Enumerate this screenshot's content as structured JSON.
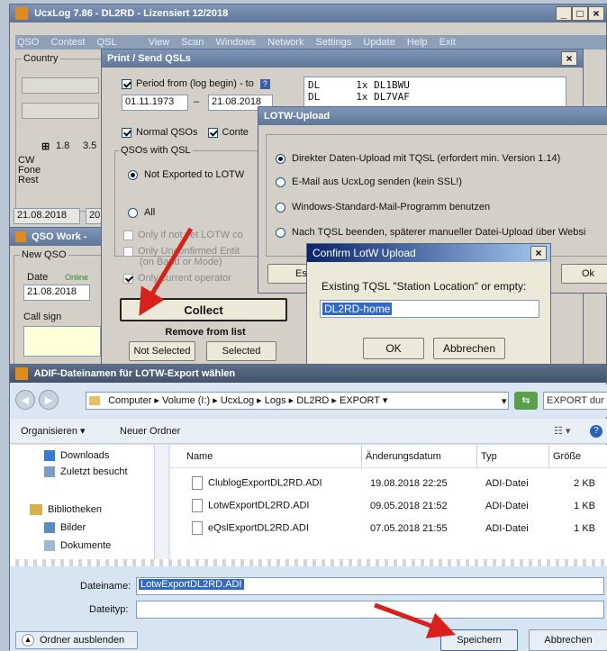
{
  "main_window": {
    "title": "UcxLog 7.86 - DL2RD - Lizensiert 12/2018",
    "menu": [
      "QSO",
      "Contest",
      "QSL",
      "View",
      "Scan",
      "Windows",
      "Network",
      "Settings",
      "Update",
      "Help",
      "Exit"
    ],
    "country_label": "Country",
    "stats_col1": "1.8",
    "stats_col2": "3.5",
    "row_labels": [
      "CW",
      "Fone",
      "Rest"
    ],
    "date_value": "21.08.2018",
    "date_partial": "20"
  },
  "qso_work": {
    "title": "QSO Work -",
    "new_qso": "New QSO",
    "date_label": "Date",
    "online_label": "Online",
    "date_value": "21.08.2018",
    "callsign_label": "Call sign"
  },
  "print_send": {
    "title": "Print / Send QSLs",
    "period_label": "Period from (log begin) - to",
    "date_from": "01.11.1973",
    "date_to": "21.08.2018",
    "normal_qsos": "Normal QSOs",
    "conte_partial": "Conte",
    "qsos_with_qsl": "QSOs with QSL",
    "not_exported": "Not Exported to LOTW",
    "all": "All",
    "only_not_yet": "Only if not yet LOTW co",
    "only_unconfirmed": "Only Unconfirmed Entit",
    "on_band_mode": "(on Band or Mode)",
    "only_current": "Only current operator",
    "collect": "Collect",
    "remove_from_list": "Remove from list",
    "not_selected": "Not Selected",
    "selected": "Selected",
    "list_rows": [
      {
        "a": "DL",
        "b": "1x DL1BWU"
      },
      {
        "a": "DL",
        "b": "1x DL7VAF"
      }
    ]
  },
  "lotw_upload": {
    "title": "LOTW-Upload",
    "opt1": "Direkter Daten-Upload mit TQSL (erfordert min. Version 1.14)",
    "opt2": "E-Mail aus UcxLog senden (kein SSL!)",
    "opt3": "Windows-Standard-Mail-Programm benutzen",
    "opt4": "Nach TQSL beenden, späterer manueller Datei-Upload über Websi",
    "es_partial": "Es",
    "ok": "Ok"
  },
  "confirm": {
    "title": "Confirm LotW Upload",
    "prompt": "Existing TQSL \"Station Location\" or empty:",
    "value": "DL2RD-home",
    "ok": "OK",
    "cancel": "Abbrechen"
  },
  "adif": {
    "title": "ADIF-Dateinamen für LOTW-Export wählen",
    "breadcrumb": [
      "Computer",
      "Volume (I:)",
      "UcxLog",
      "Logs",
      "DL2RD",
      "EXPORT"
    ],
    "search_placeholder": "EXPORT dur",
    "organize": "Organisieren",
    "new_folder": "Neuer Ordner",
    "nav": [
      "Downloads",
      "Zuletzt besucht",
      "Bibliotheken",
      "Bilder",
      "Dokumente"
    ],
    "columns": [
      "Name",
      "Änderungsdatum",
      "Typ",
      "Größe"
    ],
    "files": [
      {
        "name": "ClublogExportDL2RD.ADI",
        "date": "19.08.2018 22:25",
        "type": "ADI-Datei",
        "size": "2 KB"
      },
      {
        "name": "LotwExportDL2RD.ADI",
        "date": "09.05.2018 21:52",
        "type": "ADI-Datei",
        "size": "1 KB"
      },
      {
        "name": "eQslExportDL2RD.ADI",
        "date": "07.05.2018 21:55",
        "type": "ADI-Datei",
        "size": "1 KB"
      }
    ],
    "filename_label": "Dateiname:",
    "filename_value": "LotwExportDL2RD.ADI",
    "filetype_label": "Dateityp:",
    "hide_folders": "Ordner ausblenden",
    "save": "Speichern",
    "cancel": "Abbrechen"
  },
  "colors": {
    "arrow": "#d8211d",
    "selection": "#316ac5"
  }
}
